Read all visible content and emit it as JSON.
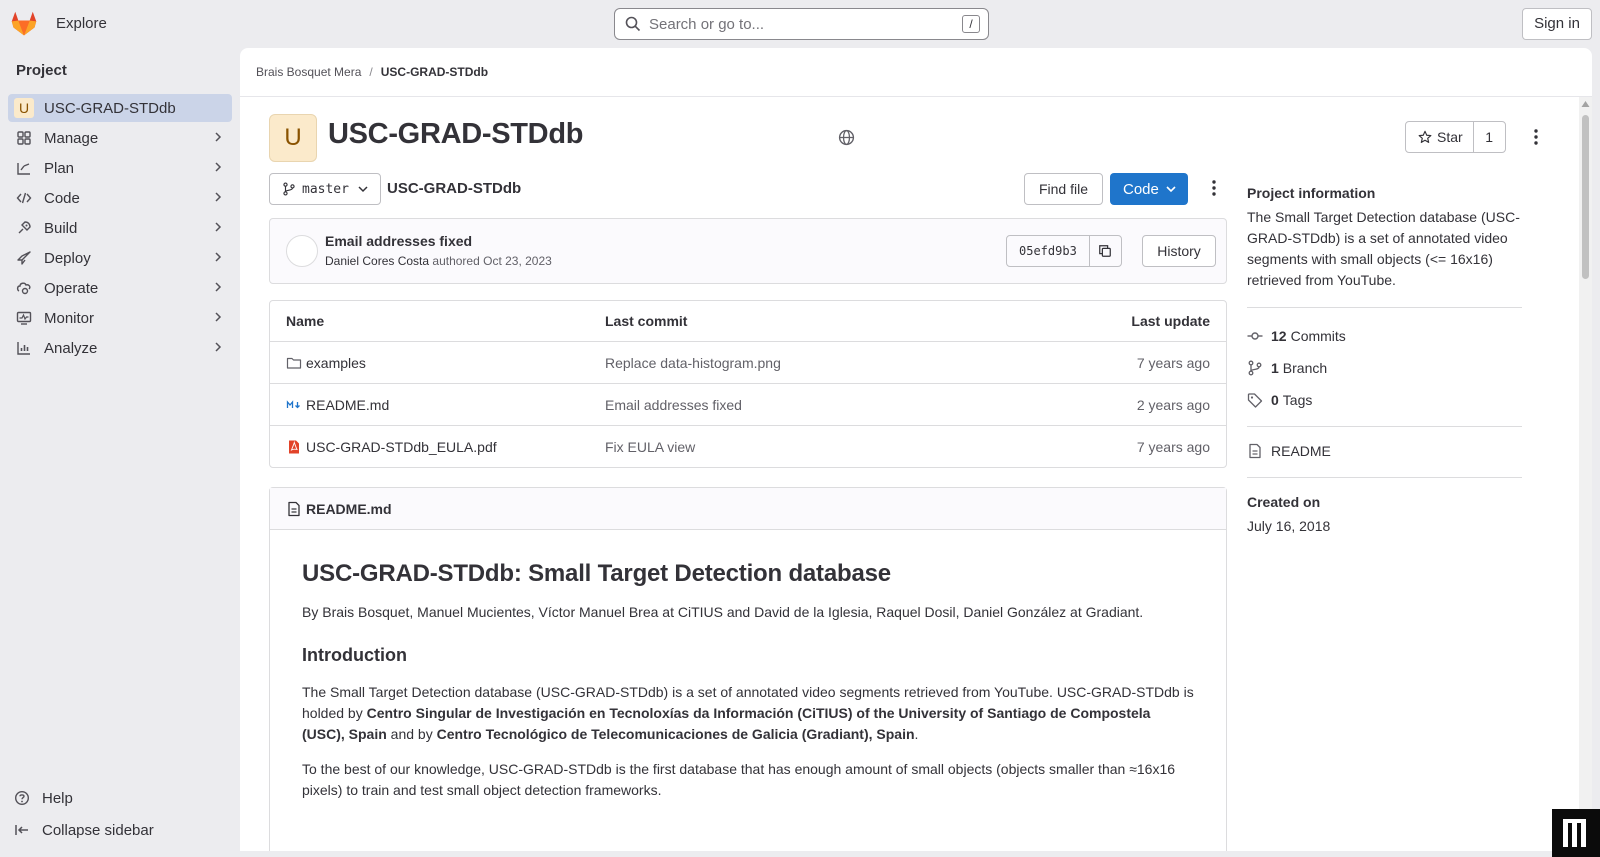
{
  "topbar": {
    "explore_label": "Explore",
    "search_placeholder": "Search or go to...",
    "search_shortcut": "/",
    "signin_label": "Sign in"
  },
  "sidebar": {
    "heading": "Project",
    "project": {
      "avatar_letter": "U",
      "label": "USC-GRAD-STDdb"
    },
    "items": [
      {
        "label": "Manage",
        "icon": "manage-icon"
      },
      {
        "label": "Plan",
        "icon": "plan-icon"
      },
      {
        "label": "Code",
        "icon": "code-icon"
      },
      {
        "label": "Build",
        "icon": "build-icon"
      },
      {
        "label": "Deploy",
        "icon": "deploy-icon"
      },
      {
        "label": "Operate",
        "icon": "operate-icon"
      },
      {
        "label": "Monitor",
        "icon": "monitor-icon"
      },
      {
        "label": "Analyze",
        "icon": "analyze-icon"
      }
    ],
    "help_label": "Help",
    "collapse_label": "Collapse sidebar"
  },
  "breadcrumb": {
    "parent": "Brais Bosquet Mera",
    "separator": "/",
    "current": "USC-GRAD-STDdb"
  },
  "project": {
    "avatar_letter": "U",
    "title": "USC-GRAD-STDdb",
    "star_label": "Star",
    "star_count": "1"
  },
  "repo": {
    "branch": "master",
    "path": "USC-GRAD-STDdb",
    "find_file_label": "Find file",
    "code_label": "Code"
  },
  "last_commit": {
    "title": "Email addresses fixed",
    "author": "Daniel Cores Costa",
    "action": "authored",
    "date": "Oct 23, 2023",
    "sha": "05efd9b3",
    "history_label": "History"
  },
  "files": {
    "headers": {
      "name": "Name",
      "commit": "Last commit",
      "update": "Last update"
    },
    "rows": [
      {
        "name": "examples",
        "type": "folder",
        "commit": "Replace data-histogram.png",
        "update": "7 years ago"
      },
      {
        "name": "README.md",
        "type": "markdown",
        "commit": "Email addresses fixed",
        "update": "2 years ago"
      },
      {
        "name": "USC-GRAD-STDdb_EULA.pdf",
        "type": "pdf",
        "commit": "Fix EULA view",
        "update": "7 years ago"
      }
    ]
  },
  "readme": {
    "filename": "README.md",
    "h1": "USC-GRAD-STDdb: Small Target Detection database",
    "byline": "By Brais Bosquet, Manuel Mucientes, Víctor Manuel Brea at CiTIUS and David de la Iglesia, Raquel Dosil, Daniel González at Gradiant.",
    "h2": "Introduction",
    "intro_text_1": "The Small Target Detection database (USC-GRAD-STDdb) is a set of annotated video segments retrieved from YouTube. USC-GRAD-STDdb is holded by ",
    "intro_bold_1": "Centro Singular de Investigación en Tecnoloxías da Información (CiTIUS) of the University of Santiago de Compostela (USC), Spain",
    "intro_text_2": " and by ",
    "intro_bold_2": "Centro Tecnológico de Telecomunicaciones de Galicia (Gradiant), Spain",
    "intro_text_3": ".",
    "para2": "To the best of our knowledge, USC-GRAD-STDdb is the first database that has enough amount of small objects (objects smaller than ≈16x16 pixels) to train and test small object detection frameworks."
  },
  "project_info": {
    "title": "Project information",
    "description": "The Small Target Detection database (USC-GRAD-STDdb) is a set of annotated video segments with small objects (<= 16x16) retrieved from YouTube.",
    "commits_count": "12",
    "commits_label": "Commits",
    "branches_count": "1",
    "branches_label": "Branch",
    "tags_count": "0",
    "tags_label": "Tags",
    "readme_label": "README",
    "created_label": "Created on",
    "created_value": "July 16, 2018"
  },
  "colors": {
    "brand_orange": "#fc6d26",
    "primary_blue": "#1f75cb",
    "sidebar_active": "#cbd4e8",
    "avatar_bg": "#fbeacb"
  }
}
